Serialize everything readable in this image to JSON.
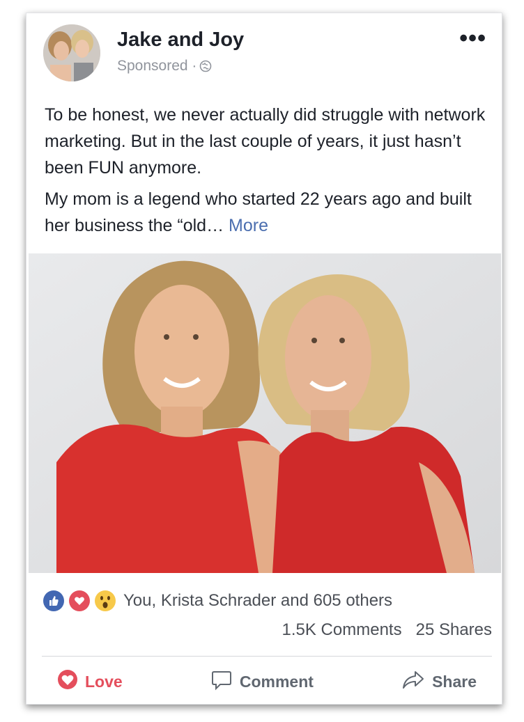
{
  "post": {
    "author": "Jake and Joy",
    "sponsored_label": "Sponsored ·",
    "more_menu": "•••",
    "paragraphs": [
      "To be honest, we never actually did struggle with network marketing. But in the last couple of years, it just hasn’t been FUN anymore.",
      "My mom is a legend who started 22 years ago and built her business the “old…"
    ],
    "see_more": "More"
  },
  "reactions": {
    "icons": [
      "like-icon",
      "love-icon",
      "wow-icon"
    ],
    "names_text": "You, Krista Schrader and 605 others",
    "comments_count": "1.5K Comments",
    "shares_count": "25 Shares"
  },
  "actions": {
    "love_label": "Love",
    "comment_label": "Comment",
    "share_label": "Share"
  },
  "colors": {
    "like_blue": "#4267b2",
    "love_red": "#e44e5c",
    "wow_yellow": "#f7c94a",
    "link_blue": "#4b6eaf",
    "dress_red": "#d8312e"
  }
}
